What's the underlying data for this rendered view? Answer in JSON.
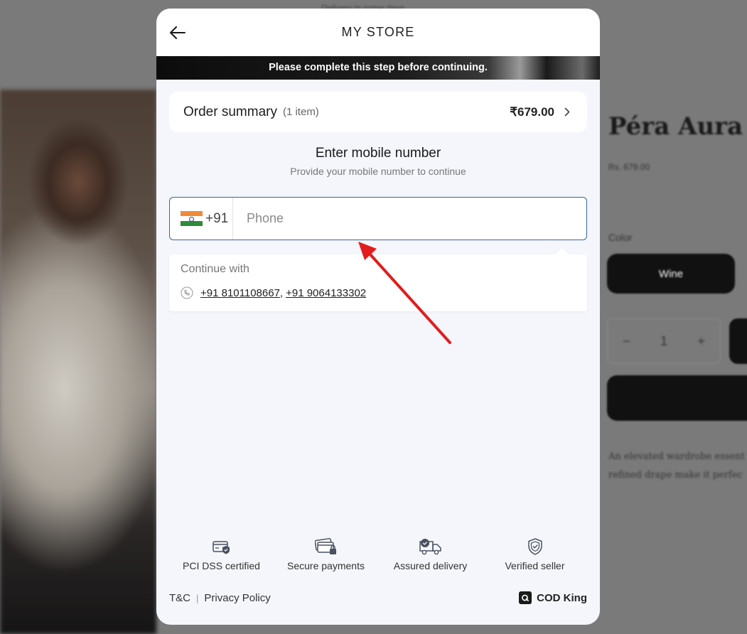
{
  "backdrop": {
    "top_note": "Delivery in some days",
    "product_title": "Péra Aura S",
    "price": "Rs. 679.00",
    "color_label": "Color",
    "swatch_label": "Wine",
    "qty_minus": "−",
    "qty_value": "1",
    "qty_plus": "+",
    "description_line1": "An elevated wardrobe essent",
    "description_line2": "refined drape make it perfec"
  },
  "modal": {
    "store_title": "MY STORE",
    "notice": "Please complete this step before continuing.",
    "order_summary": {
      "title": "Order summary",
      "count": "(1 item)",
      "total": "₹679.00"
    },
    "mobile": {
      "heading": "Enter mobile number",
      "subheading": "Provide your mobile number to continue",
      "country_code": "+91",
      "phone_placeholder": "Phone",
      "phone_value": ""
    },
    "suggestions": {
      "title": "Continue with",
      "numbers": [
        "+91 8101108667",
        "+91 9064133302"
      ],
      "separator": ","
    },
    "trust_badges": [
      {
        "label": "PCI DSS certified",
        "icon": "card-shield-icon"
      },
      {
        "label": "Secure payments",
        "icon": "card-lock-icon"
      },
      {
        "label": "Assured delivery",
        "icon": "delivery-truck-icon"
      },
      {
        "label": "Verified seller",
        "icon": "shield-check-icon"
      }
    ],
    "footer": {
      "tc": "T&C",
      "privacy": "Privacy Policy",
      "brand": "COD King"
    }
  },
  "colors": {
    "accent_border": "#3a63a8",
    "annotation_arrow": "#e11d1d",
    "modal_bg": "#f4f6fb"
  }
}
